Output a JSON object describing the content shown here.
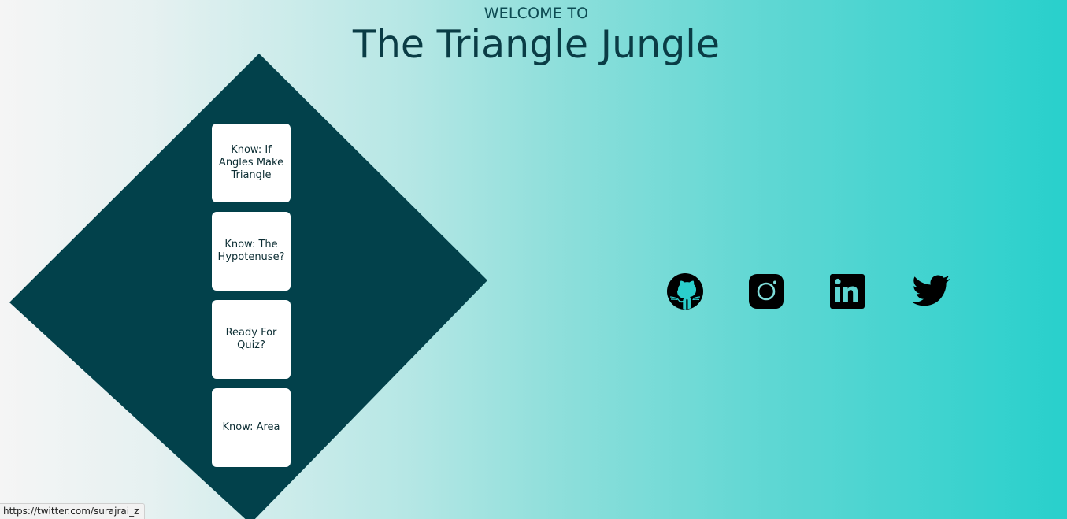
{
  "header": {
    "welcome": "WELCOME TO",
    "title": "The Triangle Jungle"
  },
  "nav_cards": [
    {
      "label": "Know: If Angles Make Triangle"
    },
    {
      "label": "Know: The Hypotenuse?"
    },
    {
      "label": "Ready For Quiz?"
    },
    {
      "label": "Know: Area"
    }
  ],
  "social_links": [
    {
      "name": "github",
      "icon": "github-icon"
    },
    {
      "name": "instagram",
      "icon": "instagram-icon"
    },
    {
      "name": "linkedin",
      "icon": "linkedin-icon"
    },
    {
      "name": "twitter",
      "icon": "twitter-icon"
    }
  ],
  "status_bar": {
    "hover_url": "https://twitter.com/surajrai_z"
  },
  "colors": {
    "diamond": "#02414b",
    "title": "#0a3c45",
    "gradient_start": "#f5f5f5",
    "gradient_end": "#28d0cc"
  }
}
